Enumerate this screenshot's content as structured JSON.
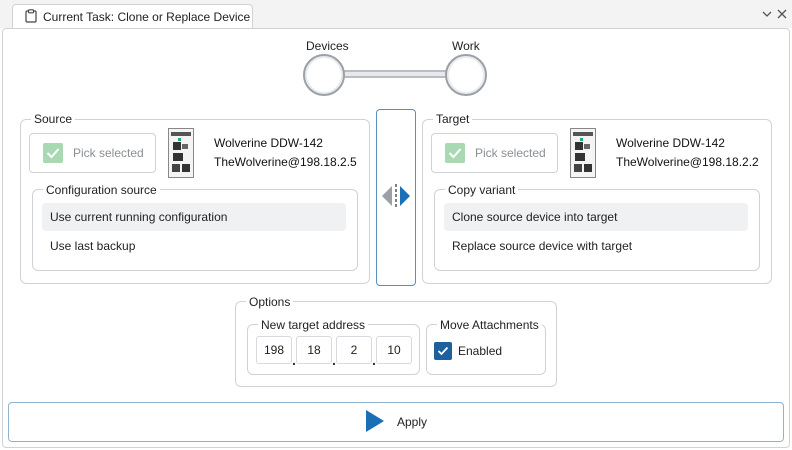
{
  "tab": {
    "title": "Current Task: Clone or Replace Device",
    "icon": "clipboard-icon"
  },
  "window_controls": {
    "chevron": "chevron-down-icon",
    "close": "close-icon"
  },
  "steps": {
    "left_label": "Devices",
    "right_label": "Work"
  },
  "source": {
    "legend": "Source",
    "pick_label": "Pick selected",
    "device_name": "Wolverine DDW-142",
    "device_address": "TheWolverine@198.18.2.5",
    "config_legend": "Configuration source",
    "options": [
      "Use current running configuration",
      "Use last backup"
    ],
    "selected_index": 0
  },
  "target": {
    "legend": "Target",
    "pick_label": "Pick selected",
    "device_name": "Wolverine DDW-142",
    "device_address": "TheWolverine@198.18.2.2",
    "variant_legend": "Copy variant",
    "options": [
      "Clone source device into target",
      "Replace source device with target"
    ],
    "selected_index": 0
  },
  "options": {
    "legend": "Options",
    "address_legend": "New target address",
    "octets": [
      "198",
      "18",
      "2",
      "10"
    ],
    "attachments_legend": "Move Attachments",
    "enabled_label": "Enabled",
    "enabled": true
  },
  "apply": {
    "label": "Apply"
  },
  "colors": {
    "accent": "#1a6fb5",
    "checkbox": "#1e5f9e",
    "ghost_check": "#a9d9b3",
    "border": "#cfd3d8"
  }
}
